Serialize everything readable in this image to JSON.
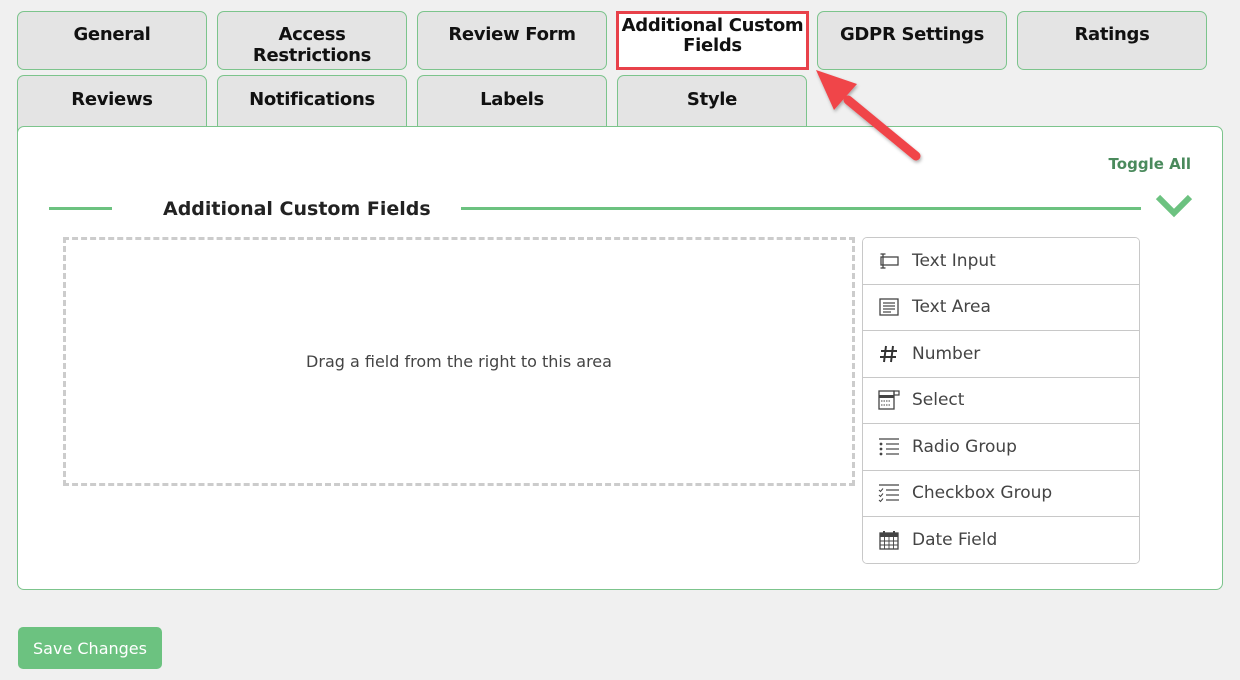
{
  "tabs": [
    {
      "label": "General",
      "active": false
    },
    {
      "label": "Access Restrictions",
      "active": false
    },
    {
      "label": "Review Form",
      "active": false
    },
    {
      "label": "Additional Custom Fields",
      "active": true
    },
    {
      "label": "GDPR Settings",
      "active": false
    },
    {
      "label": "Ratings",
      "active": false
    },
    {
      "label": "Reviews",
      "active": false
    },
    {
      "label": "Notifications",
      "active": false
    },
    {
      "label": "Labels",
      "active": false
    },
    {
      "label": "Style",
      "active": false
    }
  ],
  "panel": {
    "toggle_all": "Toggle All",
    "section_title": "Additional Custom Fields",
    "dropzone_text": "Drag a field from the right to this area",
    "fields": [
      {
        "label": "Text Input",
        "icon": "text-input-icon"
      },
      {
        "label": "Text Area",
        "icon": "text-area-icon"
      },
      {
        "label": "Number",
        "icon": "hash-icon"
      },
      {
        "label": "Select",
        "icon": "select-icon"
      },
      {
        "label": "Radio Group",
        "icon": "radio-list-icon"
      },
      {
        "label": "Checkbox Group",
        "icon": "checkbox-list-icon"
      },
      {
        "label": "Date Field",
        "icon": "calendar-icon"
      }
    ]
  },
  "save_button": "Save Changes",
  "colors": {
    "accent_green": "#6cc280",
    "highlight_red": "#e8414a",
    "toggle_text": "#4a8a5c"
  }
}
